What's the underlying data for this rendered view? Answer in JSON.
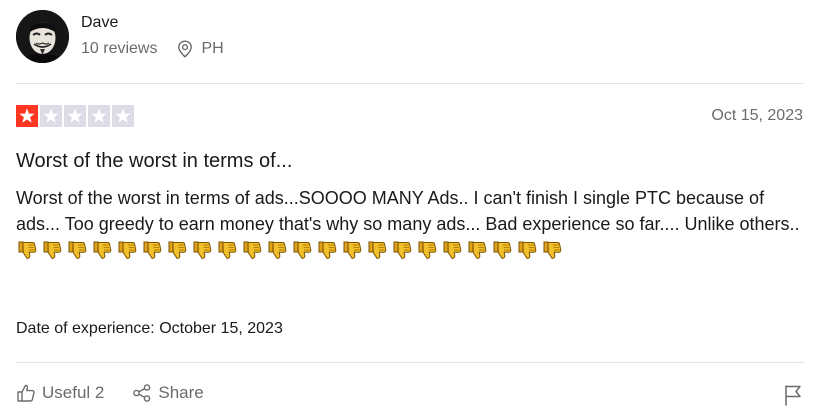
{
  "consumer": {
    "name": "Dave",
    "reviews": "10 reviews",
    "location": "PH"
  },
  "review": {
    "rating": 1,
    "rating_max": 5,
    "date": "Oct 15, 2023",
    "title": "Worst of the worst in terms of...",
    "body": "Worst of the worst in terms of ads...SOOOO MANY Ads.. I can't finish I single PTC because of ads... Too greedy to earn money that's why so many ads... Bad experience so far.... Unlike others.. ",
    "thumbs_down_count": 22,
    "experience_date": "Date of experience: October 15, 2023"
  },
  "actions": {
    "useful_label": "Useful 2",
    "share_label": "Share"
  },
  "colors": {
    "star_on": "#ff3722",
    "star_off": "#dcdce6",
    "muted_text": "#6b6b6b",
    "text": "#1a1a1a"
  },
  "icons": {
    "location": "location-pin-icon",
    "useful": "thumbs-up-icon",
    "share": "share-icon",
    "flag": "flag-icon",
    "emoji": "thumbs-down-emoji-icon"
  }
}
